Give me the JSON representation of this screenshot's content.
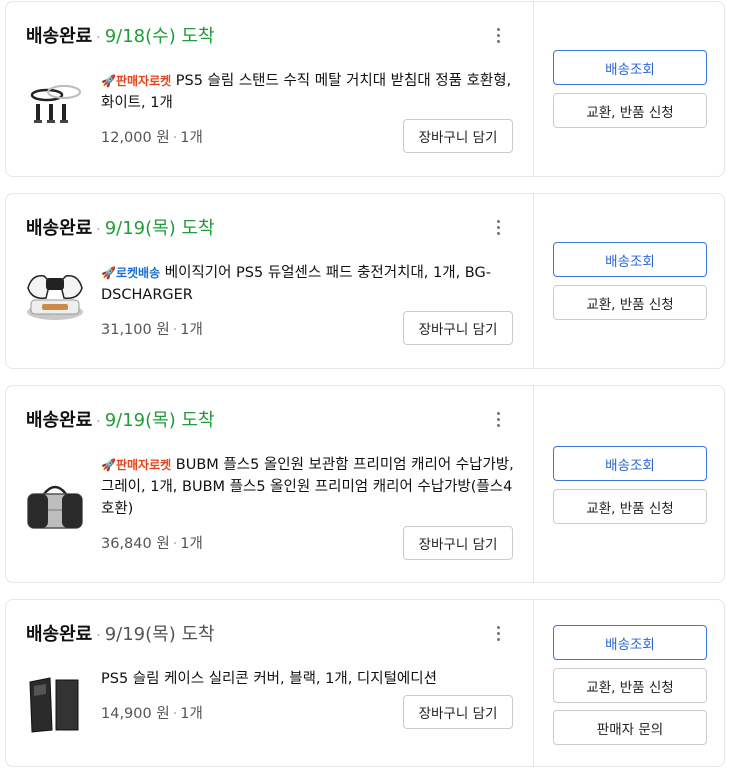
{
  "orders": [
    {
      "status": "배송완료",
      "separator": "·",
      "date": "9/18(수) 도착",
      "badge_type": "seller",
      "badge_icon": "rocket-icon",
      "badge_label": "판매자로켓",
      "title": "PS5 슬림 스탠드 수직 메탈 거치대 받침대 정품 호환형, 화이트, 1개",
      "price": "12,000 원",
      "qty": "1개",
      "image_icon": "stand-product-image",
      "cart_button": "장바구니 담기",
      "buttons": [
        "배송조회",
        "교환, 반품 신청"
      ]
    },
    {
      "status": "배송완료",
      "separator": "·",
      "date": "9/19(목) 도착",
      "badge_type": "rocket",
      "badge_icon": "rocket-icon",
      "badge_label": "로켓배송",
      "title": "베이직기어 PS5 듀얼센스 패드 충전거치대, 1개, BG-DSCHARGER",
      "price": "31,100 원",
      "qty": "1개",
      "image_icon": "charger-product-image",
      "cart_button": "장바구니 담기",
      "buttons": [
        "배송조회",
        "교환, 반품 신청"
      ]
    },
    {
      "status": "배송완료",
      "separator": "·",
      "date": "9/19(목) 도착",
      "badge_type": "seller",
      "badge_icon": "rocket-icon",
      "badge_label": "판매자로켓",
      "title": "BUBM 플스5 올인원 보관함 프리미엄 캐리어 수납가방, 그레이, 1개, BUBM 플스5 올인원 프리미엄 캐리어 수납가방(플스4 호환)",
      "price": "36,840 원",
      "qty": "1개",
      "image_icon": "bag-product-image",
      "cart_button": "장바구니 담기",
      "buttons": [
        "배송조회",
        "교환, 반품 신청"
      ]
    },
    {
      "status": "배송완료",
      "separator": "·",
      "date": "9/19(목) 도착",
      "badge_type": "",
      "badge_icon": "",
      "badge_label": "",
      "title": "PS5 슬림 케이스 실리콘 커버, 블랙, 1개, 디지털에디션",
      "price": "14,900 원",
      "qty": "1개",
      "image_icon": "case-product-image",
      "cart_button": "장바구니 담기",
      "buttons": [
        "배송조회",
        "교환, 반품 신청",
        "판매자 문의"
      ]
    }
  ],
  "colors": {
    "date_green": "#1f9d3a",
    "seller_badge": "#e8431a",
    "rocket_badge": "#1a6fd6",
    "primary_button": "#3a78e0"
  }
}
